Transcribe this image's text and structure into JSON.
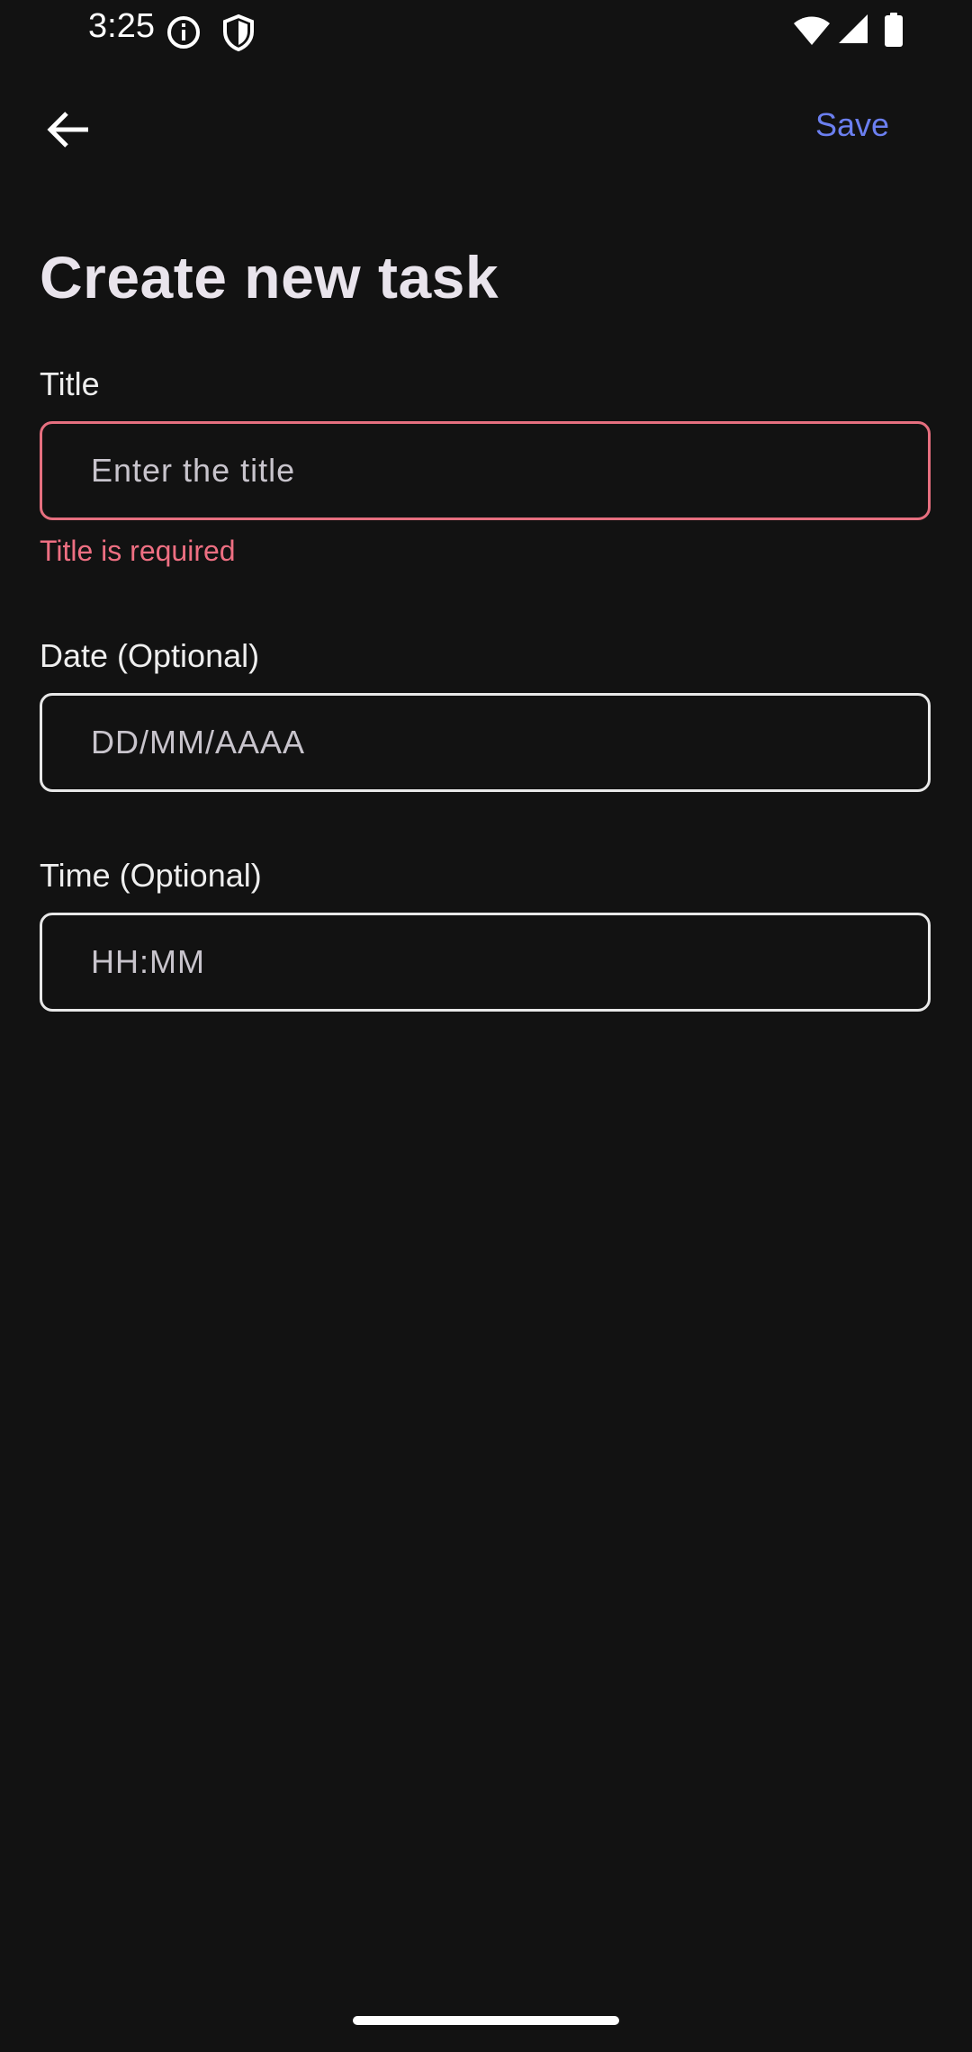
{
  "status_bar": {
    "time": "3:25",
    "icons": [
      "info-icon",
      "shield-icon",
      "wifi-icon",
      "signal-icon",
      "battery-icon"
    ]
  },
  "app_bar": {
    "back_icon": "arrow-left-icon",
    "save_label": "Save"
  },
  "page": {
    "title": "Create new task"
  },
  "form": {
    "title": {
      "label": "Title",
      "placeholder": "Enter the title",
      "error": "Title is required"
    },
    "date": {
      "label": "Date (Optional)",
      "placeholder": "DD/MM/AAAA"
    },
    "time": {
      "label": "Time (Optional)",
      "placeholder": "HH:MM"
    }
  },
  "colors": {
    "background": "#121212",
    "accent": "#6b7ff0",
    "error": "#ee6f82",
    "border": "#e8e8e8"
  }
}
